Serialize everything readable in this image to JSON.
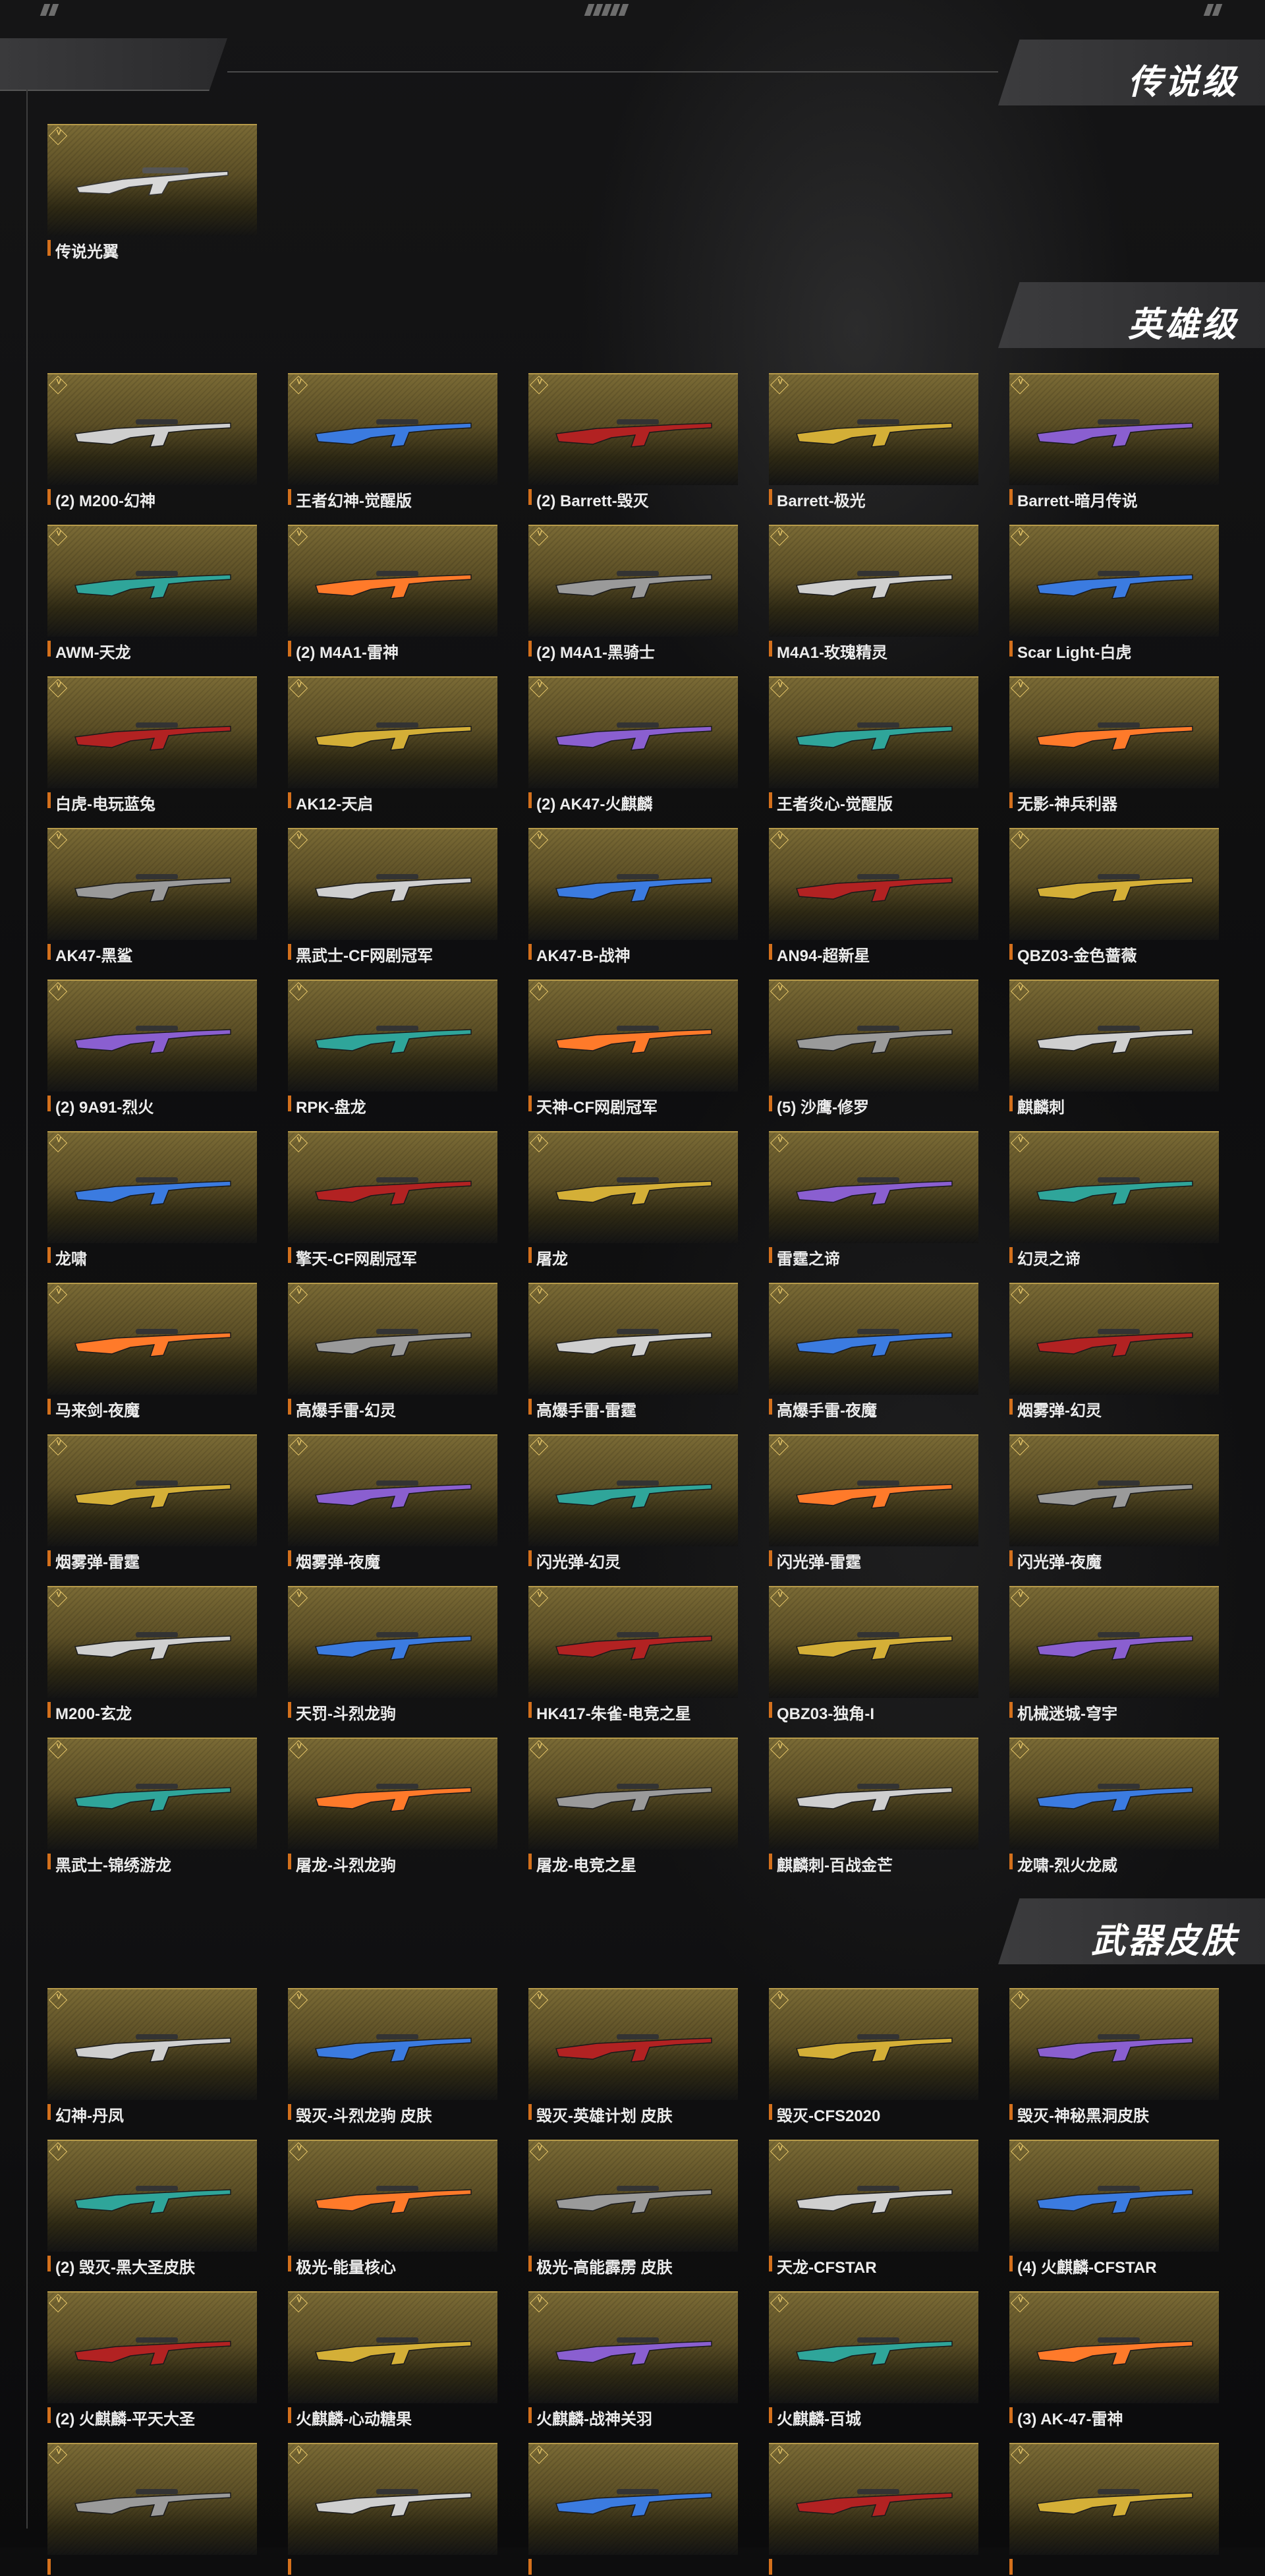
{
  "theme": {
    "accent": "#d4701c",
    "card_gold": "#7a6a35",
    "card_edge": "#b69a4a"
  },
  "sections": [
    {
      "title": "传说级",
      "items": [
        "传说光翼"
      ]
    },
    {
      "title": "英雄级",
      "items": [
        "(2) M200-幻神",
        "王者幻神-觉醒版",
        "(2) Barrett-毁灭",
        "Barrett-极光",
        "Barrett-暗月传说",
        "AWM-天龙",
        "(2) M4A1-雷神",
        "(2) M4A1-黑骑士",
        "M4A1-玫瑰精灵",
        "Scar Light-白虎",
        "白虎-电玩蓝兔",
        "AK12-天启",
        "(2) AK47-火麒麟",
        "王者炎心-觉醒版",
        "无影-神兵利器",
        "AK47-黑鲨",
        "黑武士-CF网剧冠军",
        "AK47-B-战神",
        "AN94-超新星",
        "QBZ03-金色蔷薇",
        "(2) 9A91-烈火",
        "RPK-盘龙",
        "天神-CF网剧冠军",
        "(5) 沙鹰-修罗",
        "麒麟刺",
        "龙啸",
        "擎天-CF网剧冠军",
        "屠龙",
        "雷霆之谛",
        "幻灵之谛",
        "马来剑-夜魔",
        "高爆手雷-幻灵",
        "高爆手雷-雷霆",
        "高爆手雷-夜魔",
        "烟雾弹-幻灵",
        "烟雾弹-雷霆",
        "烟雾弹-夜魔",
        "闪光弹-幻灵",
        "闪光弹-雷霆",
        "闪光弹-夜魔",
        "M200-玄龙",
        "天罚-斗烈龙驹",
        "HK417-朱雀-电竞之星",
        "QBZ03-独角-I",
        "机械迷城-穹宇",
        "黑武士-锦绣游龙",
        "屠龙-斗烈龙驹",
        "屠龙-电竞之星",
        "麒麟刺-百战金芒",
        "龙啸-烈火龙威"
      ]
    },
    {
      "title": "武器皮肤",
      "items": [
        "幻神-丹凤",
        "毁灭-斗烈龙驹 皮肤",
        "毁灭-英雄计划 皮肤",
        "毁灭-CFS2020",
        "毁灭-神秘黑洞皮肤",
        "(2) 毁灭-黑大圣皮肤",
        "极光-能量核心",
        "极光-高能霹雳 皮肤",
        "天龙-CFSTAR",
        "(4) 火麒麟-CFSTAR",
        "(2) 火麒麟-平天大圣",
        "火麒麟-心动糖果",
        "火麒麟-战神关羽",
        "火麒麟-百城",
        "(3) AK-47-雷神",
        "",
        "",
        "",
        "",
        ""
      ]
    }
  ]
}
